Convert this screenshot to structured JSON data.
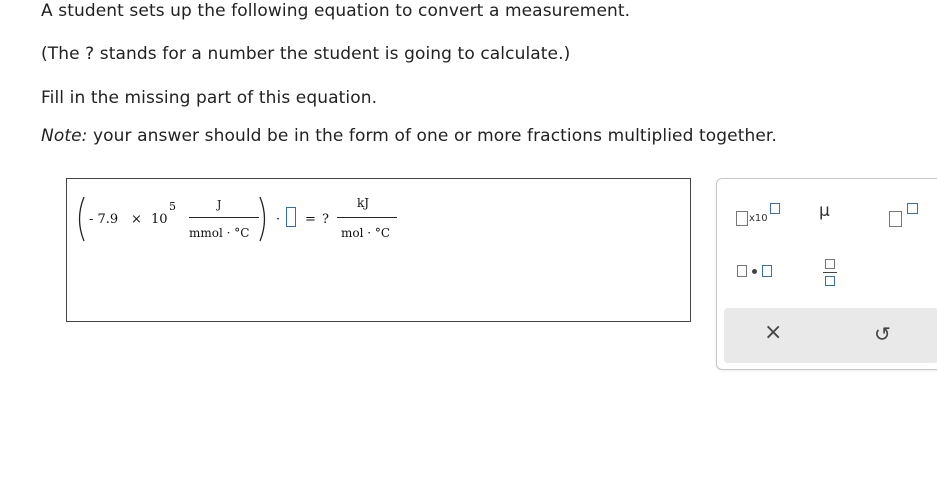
{
  "instructions": {
    "line1": "A student sets up the following equation to convert a measurement.",
    "line2": "(The ? stands for a number the student is going to calculate.)",
    "line3": "Fill in the missing part of this equation.",
    "note_label": "Note:",
    "note_text": " your answer should be in the form of one or more fractions multiplied together."
  },
  "equation": {
    "sign_value": "- 7.9",
    "times": "×",
    "base": "10",
    "exponent": "5",
    "lhs_numerator": "J",
    "lhs_denominator": "mmol · °C",
    "dot": "·",
    "equals": "=",
    "unknown": "?",
    "rhs_numerator": "kJ",
    "rhs_denominator": "mol · °C"
  },
  "toolbox": {
    "sci_notation_label": "x10",
    "mu_symbol": "μ",
    "clear_symbol": "×",
    "undo_symbol": "↺"
  }
}
